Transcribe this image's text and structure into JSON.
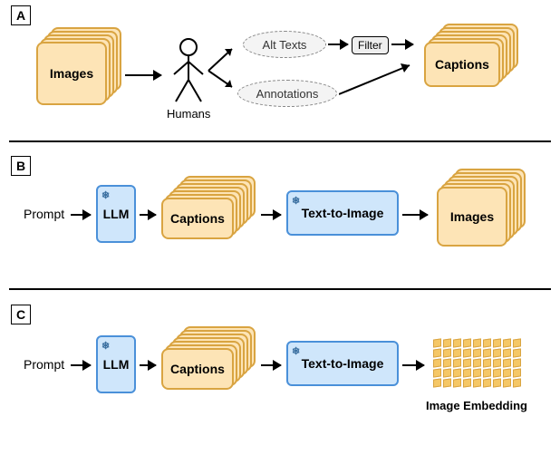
{
  "labels": {
    "panelA": "A",
    "panelB": "B",
    "panelC": "C",
    "images_stack": "Images",
    "captions_stack": "Captions",
    "humans": "Humans",
    "alt_texts": "Alt Texts",
    "annotations": "Annotations",
    "filter": "Filter",
    "prompt": "Prompt",
    "llm": "LLM",
    "t2i": "Text-to-Image",
    "img_embedding": "Image Embedding",
    "snow": "❄"
  },
  "chart_data": {
    "type": "diagram",
    "panels": [
      {
        "id": "A",
        "flow": "Images → Humans → {Alt Texts → Filter, Annotations} → Captions",
        "nodes": [
          "Images (stack)",
          "Humans (stick figure)",
          "Alt Texts (dashed ellipse)",
          "Filter (box)",
          "Annotations (dashed ellipse)",
          "Captions (stack)"
        ]
      },
      {
        "id": "B",
        "flow": "Prompt → LLM (frozen) → Captions (stack) → Text-to-Image (frozen) → Images (stack)",
        "nodes": [
          "Prompt (text)",
          "LLM (module, frozen)",
          "Captions (stack)",
          "Text-to-Image (module, frozen)",
          "Images (stack)"
        ]
      },
      {
        "id": "C",
        "flow": "Prompt → LLM (frozen) → Captions (stack) → Text-to-Image (frozen) → Image Embedding (grid of cubes)",
        "nodes": [
          "Prompt (text)",
          "LLM (module, frozen)",
          "Captions (stack)",
          "Text-to-Image (module, frozen)",
          "Image Embedding (grid)"
        ]
      }
    ]
  }
}
